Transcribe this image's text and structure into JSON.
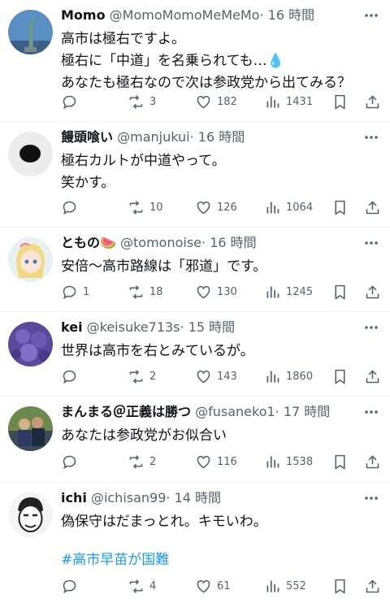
{
  "tweets": [
    {
      "name": "Momo",
      "handle": "@MomoMomoMeMeMo",
      "time": "· 16 時間",
      "lines": [
        "高市は極右ですよ。",
        "極右に「中道」を名乗られても…💧",
        "あなたも極右なので次は参政党から出てみる？"
      ],
      "hashtag": "",
      "replies": "",
      "retweets": "3",
      "likes": "182",
      "views": "1431",
      "avatar": "statue-of-liberty"
    },
    {
      "name": "饅頭喰い",
      "handle": "@manjukui",
      "time": "· 16 時間",
      "lines": [
        "極右カルトが中道やって。",
        "笑かす。"
      ],
      "hashtag": "",
      "replies": "",
      "retweets": "10",
      "likes": "126",
      "views": "1064",
      "avatar": "black-circle"
    },
    {
      "name": "ともの🍉",
      "handle": "@tomonoise",
      "time": "· 16 時間",
      "lines": [
        "安倍〜高市路線は「邪道」です。"
      ],
      "hashtag": "",
      "replies": "1",
      "retweets": "18",
      "likes": "130",
      "views": "1245",
      "avatar": "anime-character"
    },
    {
      "name": "kei",
      "handle": "@keisuke713s",
      "time": "· 15 時間",
      "lines": [
        "世界は高市を右とみているが。"
      ],
      "hashtag": "",
      "replies": "",
      "retweets": "2",
      "likes": "143",
      "views": "1860",
      "avatar": "purple-flowers"
    },
    {
      "name": "まんまる＠正義は勝つ",
      "handle": "@fusaneko1",
      "time": "· 17 時間",
      "lines": [
        "あなたは参政党がお似合い"
      ],
      "hashtag": "",
      "replies": "",
      "retweets": "2",
      "likes": "116",
      "views": "1538",
      "avatar": "people-photo"
    },
    {
      "name": "ichi",
      "handle": "@ichisan99",
      "time": "· 14 時間",
      "lines": [
        "偽保守はだまっとれ。キモいわ。"
      ],
      "hashtag": "#高市早苗が国難",
      "replies": "",
      "retweets": "4",
      "likes": "61",
      "views": "552",
      "avatar": "cartoon-face"
    }
  ]
}
